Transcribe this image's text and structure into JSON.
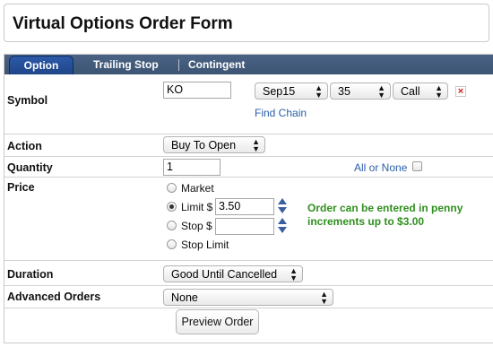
{
  "title": "Virtual Options Order Form",
  "tabs": [
    {
      "label": "Option",
      "active": true
    },
    {
      "label": "Trailing Stop",
      "active": false
    },
    {
      "label": "Contingent",
      "active": false
    }
  ],
  "symbol": {
    "label": "Symbol",
    "value": "KO",
    "expiration": "Sep15",
    "strike": "35",
    "type": "Call",
    "remove_icon": "close-icon",
    "find_chain": "Find Chain"
  },
  "action": {
    "label": "Action",
    "value": "Buy To Open"
  },
  "quantity": {
    "label": "Quantity",
    "value": "1",
    "all_or_none_label": "All or None",
    "all_or_none_checked": false
  },
  "price": {
    "label": "Price",
    "options": [
      {
        "label": "Market",
        "selected": false
      },
      {
        "label": "Limit $",
        "selected": true
      },
      {
        "label": "Stop $",
        "selected": false
      },
      {
        "label": "Stop Limit",
        "selected": false
      }
    ],
    "limit_value": "3.50",
    "stop_value": "",
    "note": "Order can be entered in penny increments up to $3.00",
    "note_color": "#2f8f1e"
  },
  "duration": {
    "label": "Duration",
    "value": "Good Until Cancelled"
  },
  "advanced": {
    "label": "Advanced Orders",
    "value": "None"
  },
  "preview_button": "Preview Order",
  "colors": {
    "tab_bar": "#3d5473",
    "active_tab": "#1f4688",
    "link": "#2a5ea8",
    "stepper": "#3a5ea0"
  }
}
